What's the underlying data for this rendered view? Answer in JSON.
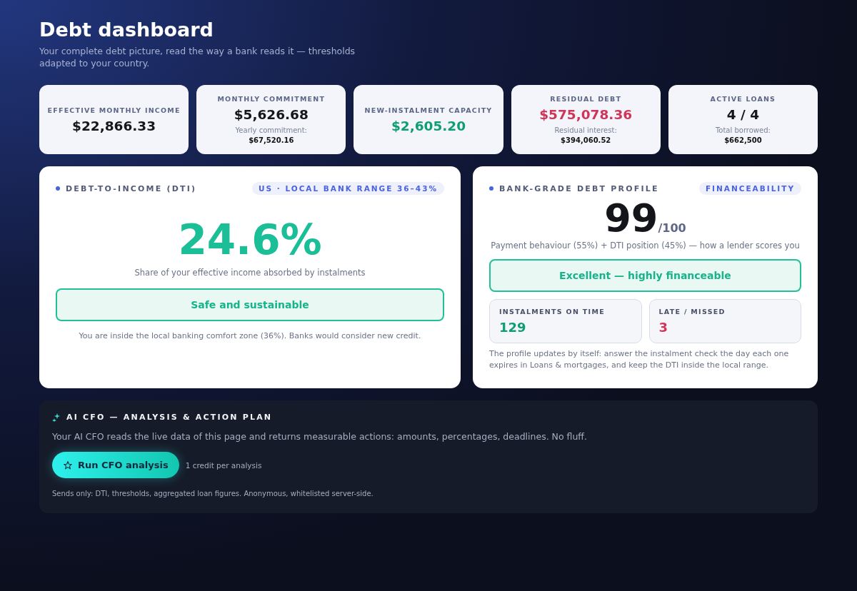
{
  "header": {
    "title": "Debt dashboard",
    "subtitle": "Your complete debt picture, read the way a bank reads it — thresholds adapted to your country."
  },
  "stats": [
    {
      "label": "EFFECTIVE MONTHLY INCOME",
      "value": "$22,866.33",
      "color": "#15161c"
    },
    {
      "label": "MONTHLY COMMITMENT",
      "value": "$5,626.68",
      "color": "#15161c",
      "note": "Yearly commitment:",
      "note_value": "$67,520.16"
    },
    {
      "label": "NEW-INSTALMENT CAPACITY",
      "value": "$2,605.20",
      "color": "#0f9d74"
    },
    {
      "label": "RESIDUAL DEBT",
      "value": "$575,078.36",
      "color": "#d03459",
      "note": "Residual interest:",
      "note_value": "$394,060.52"
    },
    {
      "label": "ACTIVE LOANS",
      "value": "4 / 4",
      "color": "#15161c",
      "note": "Total borrowed:",
      "note_value": "$662,500"
    }
  ],
  "dti": {
    "title": "DEBT-TO-INCOME (DTI)",
    "badge": "US · LOCAL BANK RANGE 36–43%",
    "value": "24.6%",
    "caption": "Share of your effective income absorbed by instalments",
    "verdict": "Safe and sustainable",
    "note": "You are inside the local banking comfort zone (36%). Banks would consider new credit."
  },
  "profile": {
    "title": "BANK-GRADE DEBT PROFILE",
    "badge": "FINANCEABILITY",
    "score": "99",
    "score_max": "/100",
    "caption": "Payment behaviour (55%) + DTI position (45%) — how a lender scores you",
    "verdict": "Excellent — highly financeable",
    "counters": [
      {
        "label": "INSTALMENTS ON TIME",
        "value": "129",
        "color": "#0f9d74"
      },
      {
        "label": "LATE / MISSED",
        "value": "3",
        "color": "#d03459"
      }
    ],
    "note": "The profile updates by itself: answer the instalment check the day each one expires in Loans & mortgages, and keep the DTI inside the local range."
  },
  "ai": {
    "title": "AI CFO — ANALYSIS & ACTION PLAN",
    "description": "Your AI CFO reads the live data of this page and returns measurable actions: amounts, percentages, deadlines. No fluff.",
    "button": "Run CFO analysis",
    "cost": "1 credit per analysis",
    "footnote": "Sends only: DTI, thresholds, aggregated loan figures. Anonymous, whitelisted server-side."
  }
}
